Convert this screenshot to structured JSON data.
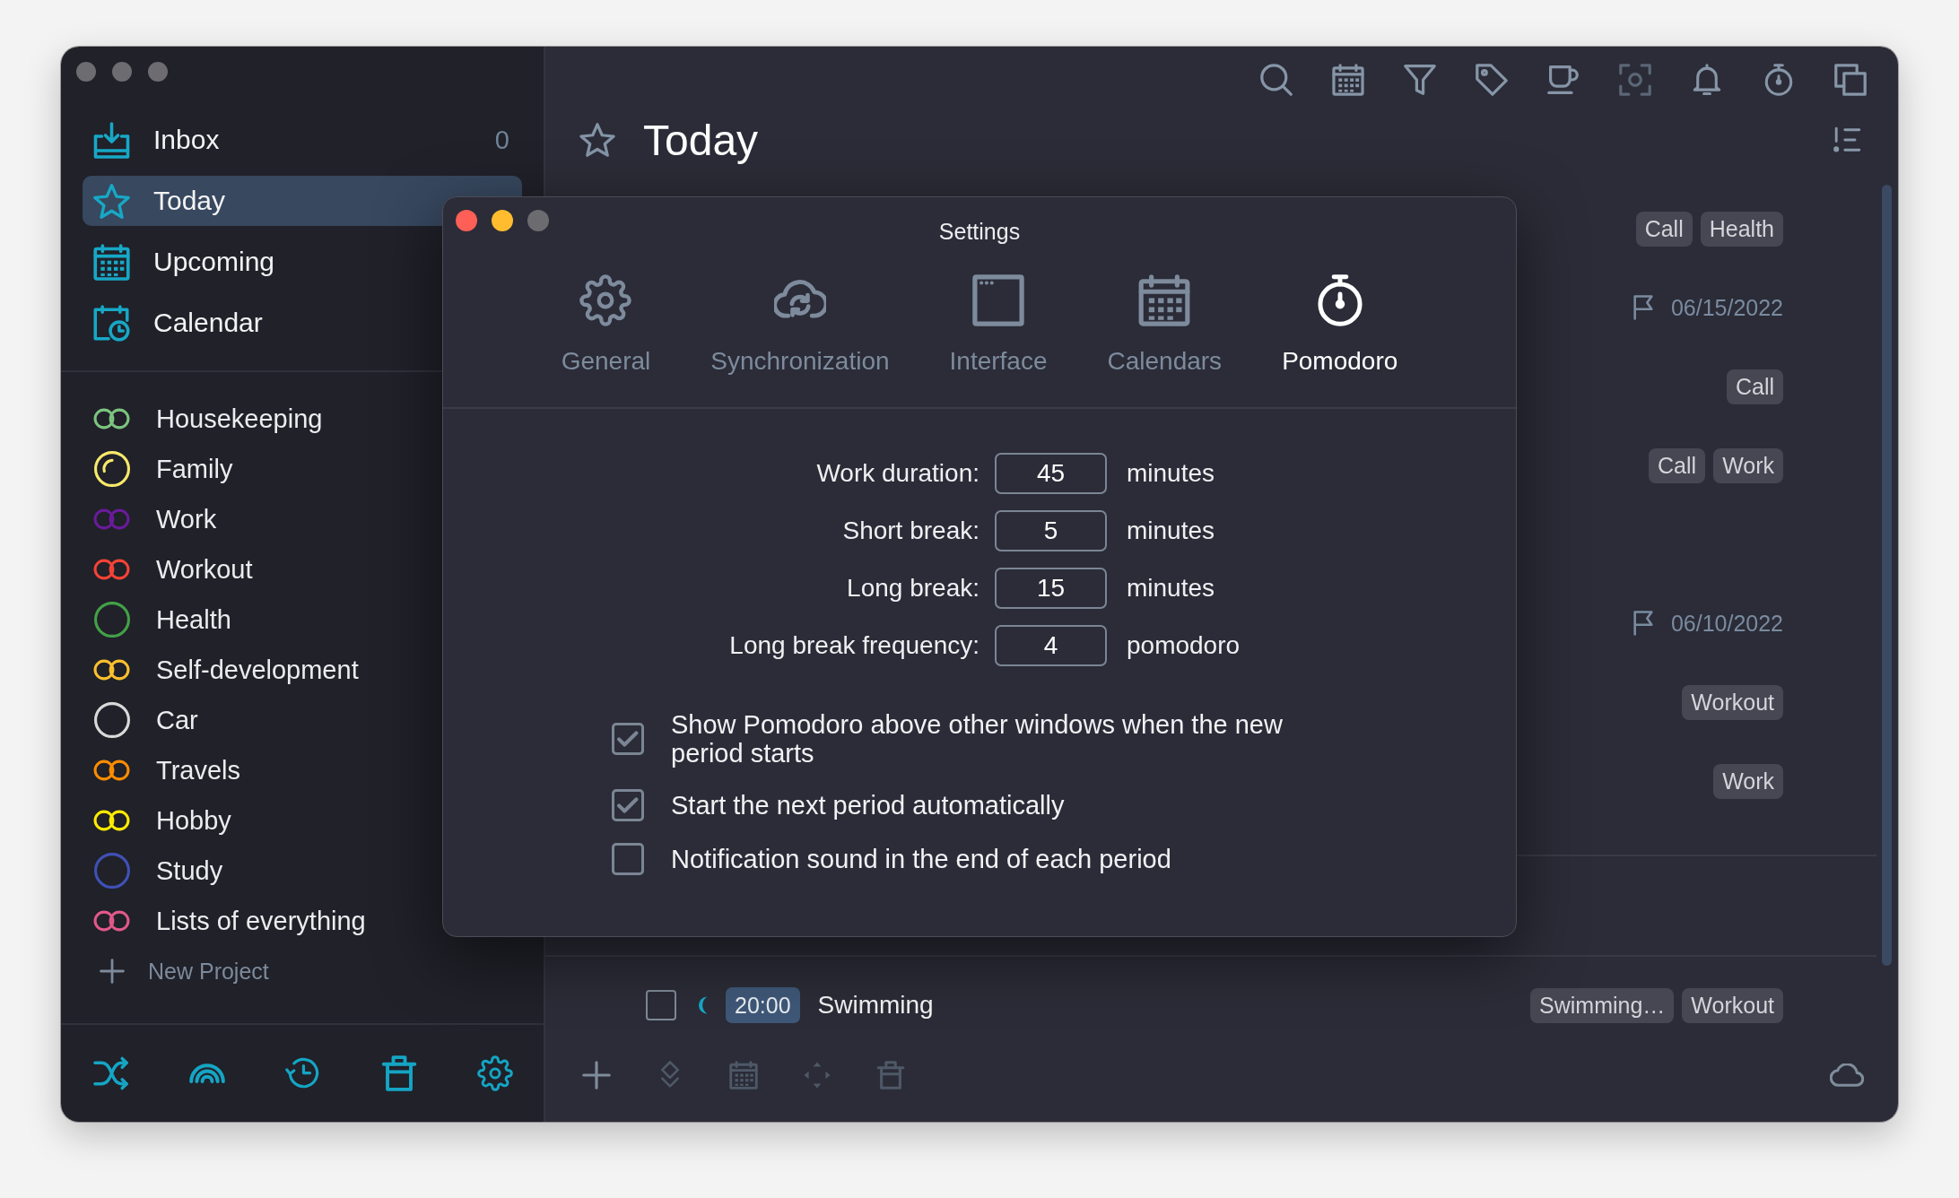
{
  "sidebar": {
    "nav": [
      {
        "kind": "inbox",
        "label": "Inbox",
        "count": "0",
        "selected": false
      },
      {
        "kind": "today",
        "label": "Today",
        "selected": true
      },
      {
        "kind": "upcoming",
        "label": "Upcoming",
        "selected": false
      },
      {
        "kind": "calendar",
        "label": "Calendar",
        "selected": false
      }
    ],
    "projects": [
      {
        "kind": "double",
        "label": "Housekeeping",
        "color": "#7cc47f"
      },
      {
        "kind": "partial",
        "label": "Family",
        "color": "#f7e96b"
      },
      {
        "kind": "double",
        "label": "Work",
        "color": "#6a1b9a"
      },
      {
        "kind": "double",
        "label": "Workout",
        "color": "#f44336"
      },
      {
        "kind": "single",
        "label": "Health",
        "color": "#43a047"
      },
      {
        "kind": "double",
        "label": "Self-development",
        "color": "#fbc02d"
      },
      {
        "kind": "single",
        "label": "Car",
        "color": "#d9d9d9"
      },
      {
        "kind": "double",
        "label": "Travels",
        "color": "#fb8c00"
      },
      {
        "kind": "double",
        "label": "Hobby",
        "color": "#ffeb00"
      },
      {
        "kind": "single",
        "label": "Study",
        "color": "#3f51b5"
      },
      {
        "kind": "double",
        "label": "Lists of everything",
        "color": "#e0588a"
      }
    ],
    "new_project": "New Project"
  },
  "main": {
    "title": "Today",
    "tasks": [
      {
        "kind": "tags",
        "tags": [
          "Call",
          "Health"
        ]
      },
      {
        "kind": "due",
        "due": "06/15/2022"
      },
      {
        "kind": "tags",
        "tags": [
          "Call"
        ]
      },
      {
        "kind": "tags",
        "tags": [
          "Call",
          "Work"
        ]
      },
      {
        "kind": "due",
        "due": "06/10/2022"
      },
      {
        "kind": "tags",
        "tags": [
          "Workout"
        ]
      },
      {
        "kind": "tags",
        "tags": [
          "Work"
        ]
      }
    ],
    "evening_task": {
      "checked": false,
      "time": "20:00",
      "title": "Swimming",
      "tags": [
        "Swimming…",
        "Workout"
      ]
    }
  },
  "settings": {
    "title": "Settings",
    "tabs": [
      {
        "kind": "general",
        "label": "General",
        "selected": false
      },
      {
        "kind": "sync",
        "label": "Synchronization",
        "selected": false
      },
      {
        "kind": "interface",
        "label": "Interface",
        "selected": false
      },
      {
        "kind": "calendars",
        "label": "Calendars",
        "selected": false
      },
      {
        "kind": "pomodoro",
        "label": "Pomodoro",
        "selected": true
      }
    ],
    "fields": [
      {
        "label": "Work duration:",
        "value": "45",
        "unit": "minutes"
      },
      {
        "label": "Short break:",
        "value": "5",
        "unit": "minutes"
      },
      {
        "label": "Long break:",
        "value": "15",
        "unit": "minutes"
      },
      {
        "label": "Long break frequency:",
        "value": "4",
        "unit": "pomodoro"
      }
    ],
    "options": [
      {
        "label": "Show Pomodoro above other windows when the new period starts",
        "checked": true
      },
      {
        "label": "Start the next period automatically",
        "checked": true
      },
      {
        "label": "Notification sound in the end of each period",
        "checked": false
      }
    ]
  }
}
